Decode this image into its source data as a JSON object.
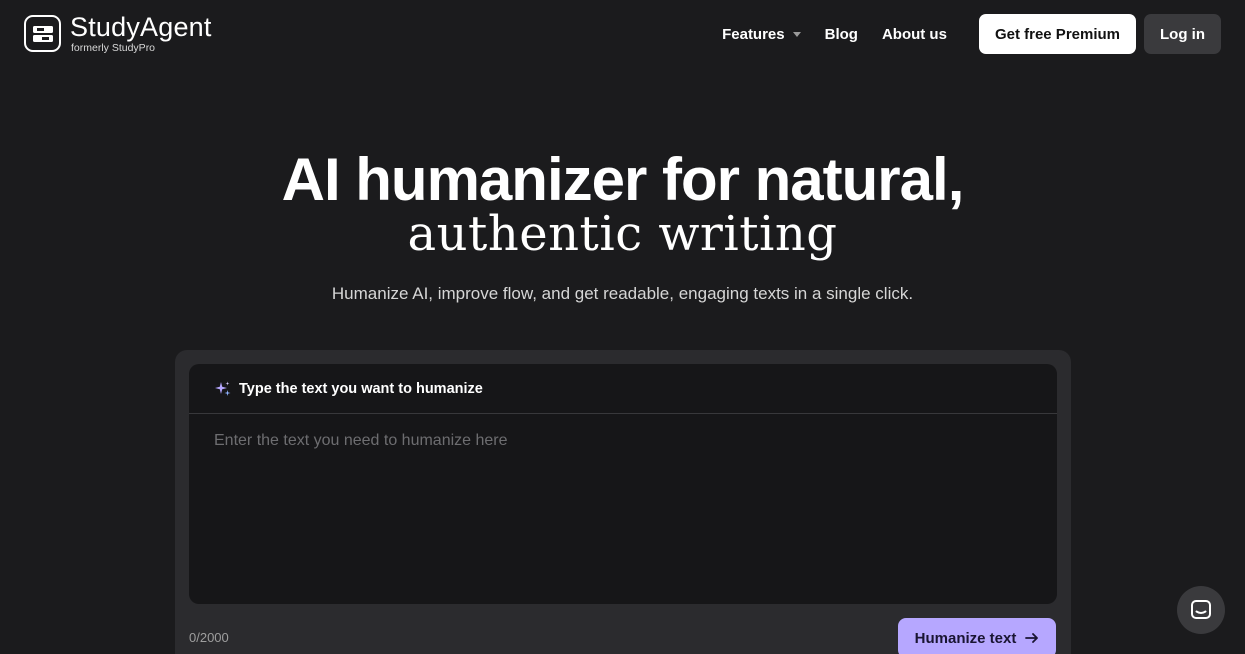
{
  "header": {
    "logo_name": "StudyAgent",
    "logo_sub": "formerly StudyPro",
    "nav": {
      "features": "Features",
      "blog": "Blog",
      "about": "About us"
    },
    "premium_button": "Get free Premium",
    "login_button": "Log in"
  },
  "hero": {
    "title_line1": "AI humanizer for natural,",
    "title_line2": "authentic writing",
    "subtitle": "Humanize AI, improve flow, and get readable, engaging texts in a single click."
  },
  "editor": {
    "title": "Type the text you want to humanize",
    "placeholder": "Enter the text you need to humanize here",
    "value": "",
    "counter": "0/2000",
    "submit_label": "Humanize text"
  },
  "colors": {
    "background": "#1b1b1d",
    "accent": "#b6a7ff",
    "card": "#2b2b2e",
    "editor": "#161618"
  },
  "icons": {
    "logo": "studyagent-logo-icon",
    "features_dropdown": "chevron-down-icon",
    "editor_header": "sparkle-icon",
    "submit": "arrow-right-icon",
    "chat": "chat-icon"
  }
}
